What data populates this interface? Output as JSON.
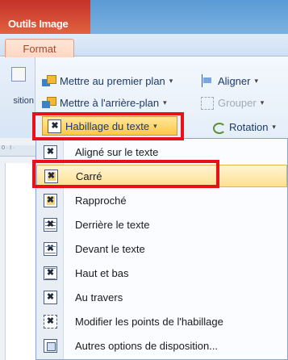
{
  "ribbon": {
    "context_title": "Outils Image",
    "active_tab": "Format",
    "left_group_label": "sition",
    "commands": {
      "bring_front": "Mettre au premier plan",
      "send_back": "Mettre à l'arrière-plan",
      "align": "Aligner",
      "group": "Grouper",
      "rotate": "Rotation",
      "text_wrapping": "Habillage du texte"
    },
    "ruler_text": "0 · I ·"
  },
  "menu": {
    "items": [
      {
        "label": "Aligné sur le texte",
        "icon": "wrap-inline-icon"
      },
      {
        "label": "Carré",
        "icon": "wrap-square-icon"
      },
      {
        "label": "Rapproché",
        "icon": "wrap-tight-icon"
      },
      {
        "label": "Derrière le texte",
        "icon": "wrap-behind-icon"
      },
      {
        "label": "Devant le texte",
        "icon": "wrap-front-icon"
      },
      {
        "label": "Haut et bas",
        "icon": "wrap-top-bottom-icon"
      },
      {
        "label": "Au travers",
        "icon": "wrap-through-icon"
      },
      {
        "label": "Modifier les points de l'habillage",
        "icon": "edit-wrap-points-icon"
      },
      {
        "label": "Autres options de disposition...",
        "icon": "more-layout-options-icon"
      }
    ]
  },
  "colors": {
    "highlight": "#e8101b",
    "hover": "#ffe08f",
    "context_tab": "#c4312a"
  }
}
